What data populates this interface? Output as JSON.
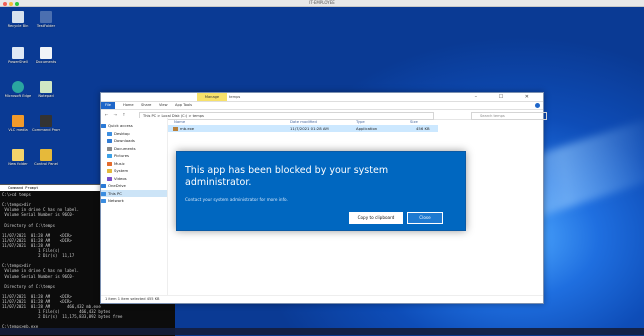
{
  "mac_title": "IT-EMPLOYEE",
  "desktop_icons": [
    {
      "label": "Recycle Bin"
    },
    {
      "label": "TestFolder"
    },
    {
      "label": "PowerShell"
    },
    {
      "label": "Documents"
    },
    {
      "label": "Microsoft Edge"
    },
    {
      "label": "Notepad"
    },
    {
      "label": "VLC media"
    },
    {
      "label": "Command Prompt"
    },
    {
      "label": "New folder"
    },
    {
      "label": "Control Panel"
    }
  ],
  "cmd": {
    "title": "Command Prompt",
    "lines": "C:\\>cd temps\n\nC:\\temps>dir\n Volume in drive C has no label.\n Volume Serial Number is 96C0-\n\n Directory of C:\\temps\n\n11/07/2021  01:28 AM    <DIR>\n11/07/2021  01:28 AM    <DIR>\n11/07/2021  01:28 AM\n               1 File(s)\n               2 Dir(s)  11,17\n\nC:\\temps>dir\n Volume in drive C has no label.\n Volume Serial Number is 96C0-\n\n Directory of C:\\temps\n\n11/07/2021  01:28 AM    <DIR>\n11/07/2021  01:28 AM    <DIR>\n11/07/2021  01:28 AM       466,432 mb.exe\n               1 File(s)        466,432 bytes\n               2 Dir(s)  11,175,833,892 bytes free\n\nC:\\temps>mb.exe"
  },
  "explorer": {
    "tab_manage": "Manage",
    "tab_temps": "temps",
    "ribbon": [
      "File",
      "Home",
      "Share",
      "View",
      "App Tools"
    ],
    "path": "This PC  >  Local Disk (C:)  >  temps",
    "search_placeholder": "Search temps",
    "sidebar": [
      {
        "label": "Quick access",
        "color": "#2a7ad8"
      },
      {
        "label": "Desktop",
        "color": "#3b8de0"
      },
      {
        "label": "Downloads",
        "color": "#2f7bd4"
      },
      {
        "label": "Documents",
        "color": "#8a8a8a"
      },
      {
        "label": "Pictures",
        "color": "#3ba0e6"
      },
      {
        "label": "Music",
        "color": "#e36b2c"
      },
      {
        "label": "System",
        "color": "#e4b83a"
      },
      {
        "label": "Videos",
        "color": "#7a4ec9"
      },
      {
        "label": "OneDrive",
        "color": "#2a7ad8"
      },
      {
        "label": "This PC",
        "color": "#3b8de0"
      },
      {
        "label": "Network",
        "color": "#3b8de0"
      }
    ],
    "columns": {
      "name": "Name",
      "date": "Date modified",
      "type": "Type",
      "size": "Size"
    },
    "file": {
      "name": "mb.exe",
      "date": "11/7/2021 01:28 AM",
      "type": "Application",
      "size": "456 KB"
    },
    "status": "1 item    1 item selected  455 KB"
  },
  "dialog": {
    "title": "This app has been blocked by your system administrator.",
    "message": "Contact your system administrator for more info.",
    "copy_button": "Copy to clipboard",
    "close_button": "Close"
  }
}
